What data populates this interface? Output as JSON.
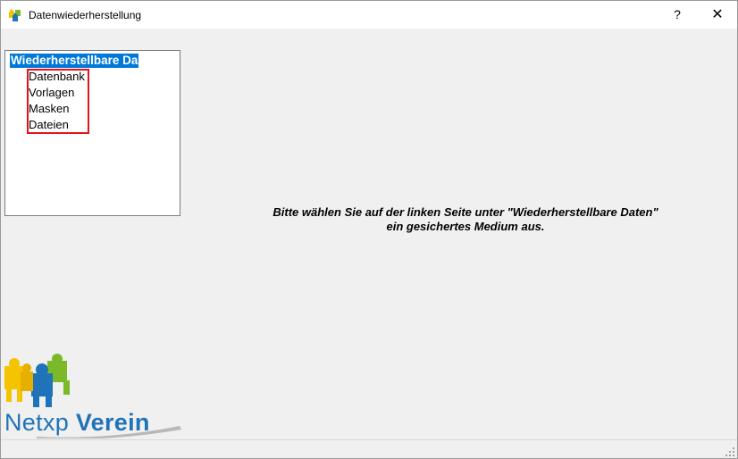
{
  "window": {
    "title": "Datenwiederherstellung",
    "help_label": "?",
    "close_label": "✕"
  },
  "tree": {
    "root_label": "Wiederherstellbare Da",
    "items": [
      {
        "label": "Datenbank"
      },
      {
        "label": "Vorlagen"
      },
      {
        "label": "Masken"
      },
      {
        "label": "Dateien"
      }
    ]
  },
  "message": {
    "line1": "Bitte wählen Sie auf der linken Seite unter \"Wiederherstellbare Daten\"",
    "line2": "ein gesichertes Medium aus."
  },
  "logo": {
    "text_part1": "Netxp",
    "text_part2": "Verein"
  },
  "colors": {
    "selection": "#0078d7",
    "highlight_border": "#e0141e",
    "logo_blue": "#1f73b8",
    "puzzle_yellow": "#f5c400",
    "puzzle_green": "#7bb929",
    "puzzle_blue": "#1f73b8"
  }
}
